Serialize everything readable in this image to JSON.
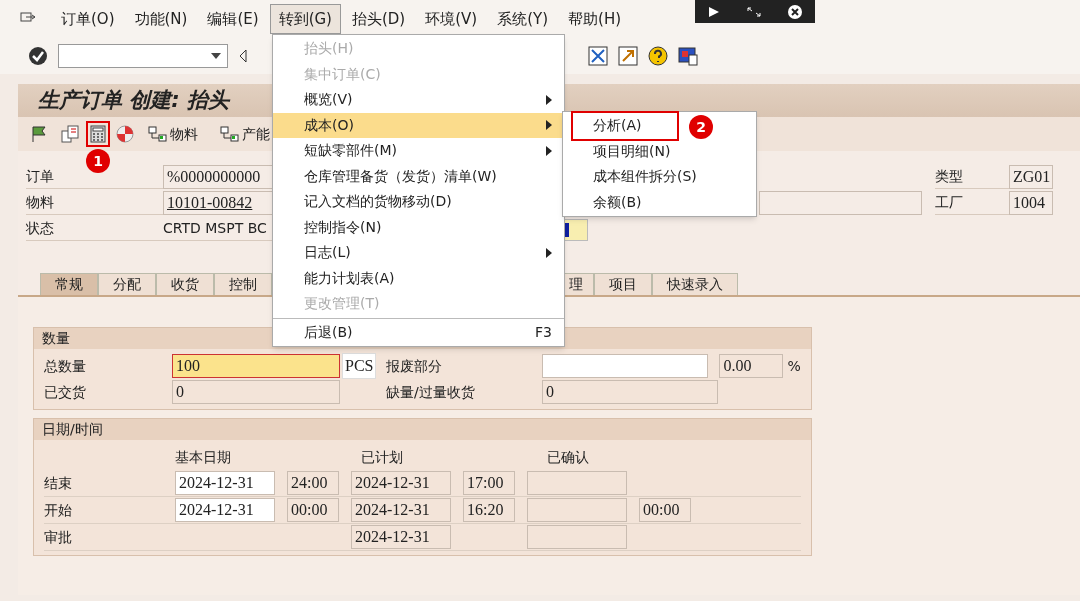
{
  "menubar": [
    {
      "label": "订单(O)",
      "selected": false
    },
    {
      "label": "功能(N)",
      "selected": false
    },
    {
      "label": "编辑(E)",
      "selected": false
    },
    {
      "label": "转到(G)",
      "selected": true
    },
    {
      "label": "抬头(D)",
      "selected": false
    },
    {
      "label": "环境(V)",
      "selected": false
    },
    {
      "label": "系统(Y)",
      "selected": false
    },
    {
      "label": "帮助(H)",
      "selected": false
    }
  ],
  "goto_menu": [
    {
      "label": "抬头(H)",
      "disabled": true,
      "selected": false,
      "submenu": false
    },
    {
      "label": "集中订单(C)",
      "disabled": true,
      "selected": false,
      "submenu": false
    },
    {
      "label": "概览(V)",
      "disabled": false,
      "selected": false,
      "submenu": true
    },
    {
      "label": "成本(O)",
      "disabled": false,
      "selected": true,
      "submenu": true
    },
    {
      "label": "短缺零部件(M)",
      "disabled": false,
      "selected": false,
      "submenu": true
    },
    {
      "label": "仓库管理备货（发货）清单(W)",
      "disabled": false,
      "selected": false,
      "submenu": false
    },
    {
      "label": "记入文档的货物移动(D)",
      "disabled": false,
      "selected": false,
      "submenu": false
    },
    {
      "label": "控制指令(N)",
      "disabled": false,
      "selected": false,
      "submenu": false
    },
    {
      "label": "日志(L)",
      "disabled": false,
      "selected": false,
      "submenu": true
    },
    {
      "label": "能力计划表(A)",
      "disabled": false,
      "selected": false,
      "submenu": false
    },
    {
      "label": "更改管理(T)",
      "disabled": true,
      "selected": false,
      "submenu": false
    },
    {
      "label": "后退(B)",
      "disabled": false,
      "selected": false,
      "submenu": false,
      "shortcut": "F3",
      "separator_before": true
    }
  ],
  "cost_submenu": [
    {
      "label": "分析(A)",
      "marked": true,
      "callout": "2"
    },
    {
      "label": "项目明细(N)",
      "marked": false
    },
    {
      "label": "成本组件拆分(S)",
      "marked": false
    },
    {
      "label": "余额(B)",
      "marked": false
    }
  ],
  "title": "生产订单 创建: 抬头",
  "app_toolbar": [
    {
      "kind": "flag",
      "marked": false
    },
    {
      "kind": "document",
      "marked": false
    },
    {
      "kind": "calculator",
      "marked": true,
      "callout": "1"
    },
    {
      "kind": "pie",
      "marked": false
    },
    {
      "kind": "material",
      "label": "物料",
      "marked": false
    },
    {
      "kind": "capacity",
      "label": "产能",
      "marked": false
    }
  ],
  "header": {
    "order_label": "订单",
    "order": "%0000000000",
    "material_label": "物料",
    "material": "10101-00842",
    "status_label": "状态",
    "status": "CRTD MSPT BC",
    "type_label": "类型",
    "type": "ZG01",
    "plant_label": "工厂",
    "plant": "1004"
  },
  "tabs": [
    {
      "label": "常规",
      "selected": true
    },
    {
      "label": "分配",
      "selected": false
    },
    {
      "label": "收货",
      "selected": false
    },
    {
      "label": "控制",
      "selected": false
    },
    {
      "label": "理",
      "selected": false
    },
    {
      "label": "项目",
      "selected": false
    },
    {
      "label": "快速录入",
      "selected": false
    }
  ],
  "quantity": {
    "title": "数量",
    "total_label": "总数量",
    "total": "100",
    "unit": "PCS",
    "scrap_label": "报废部分",
    "scrap": "0.00",
    "percent": "%",
    "delivered_label": "已交货",
    "delivered": "0",
    "short_label": "缺量/过量收货",
    "short": "0"
  },
  "dates": {
    "title": "日期/时间",
    "columns": [
      "基本日期",
      "已计划",
      "已确认"
    ],
    "rows": [
      {
        "label": "结束",
        "basic_date": "2024-12-31",
        "basic_time": "24:00",
        "planned_date": "2024-12-31",
        "planned_time": "17:00",
        "confirmed_date": ""
      },
      {
        "label": "开始",
        "basic_date": "2024-12-31",
        "basic_time": "00:00",
        "planned_date": "2024-12-31",
        "planned_time": "16:20",
        "confirmed_date": "",
        "confirmed_time": "00:00"
      },
      {
        "label": "审批",
        "planned_date": "2024-12-31",
        "confirmed_date": ""
      }
    ]
  }
}
